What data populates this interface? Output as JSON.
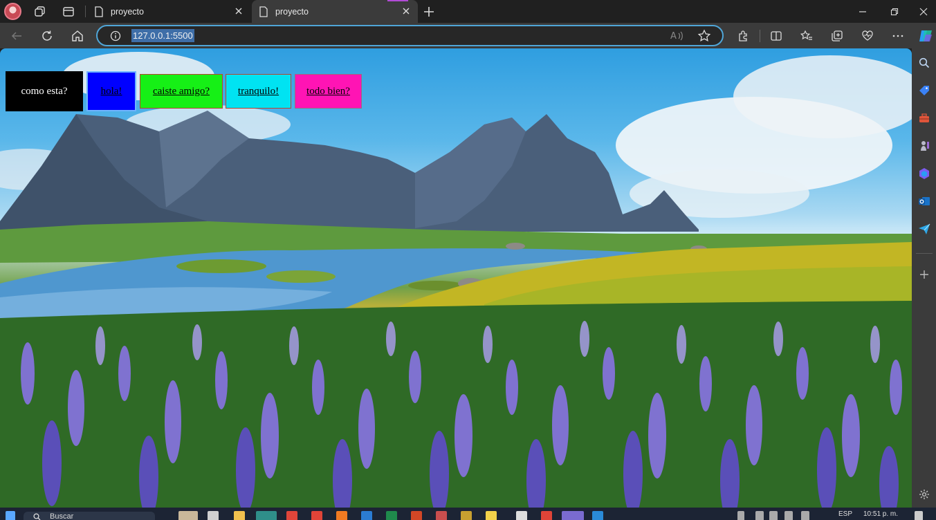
{
  "browser": {
    "tabs": [
      {
        "title": "proyecto",
        "active": false
      },
      {
        "title": "proyecto",
        "active": true
      }
    ],
    "address": {
      "url": "127.0.0.1:5500"
    },
    "accent_color": "#4fa6d8"
  },
  "page": {
    "buttons": [
      {
        "label": "como esta?",
        "color": "#000000"
      },
      {
        "label": "hola!",
        "color": "#0000ff"
      },
      {
        "label": "caiste amigo?",
        "color": "#16f016"
      },
      {
        "label": "tranquilo!",
        "color": "#00e3f2"
      },
      {
        "label": "todo bien?",
        "color": "#ff14b4"
      }
    ],
    "background": "landscape: mountains, lake, purple lupine flowers"
  },
  "taskbar": {
    "search_placeholder": "Buscar",
    "language": "ESP",
    "clock": "10:51 p. m."
  }
}
